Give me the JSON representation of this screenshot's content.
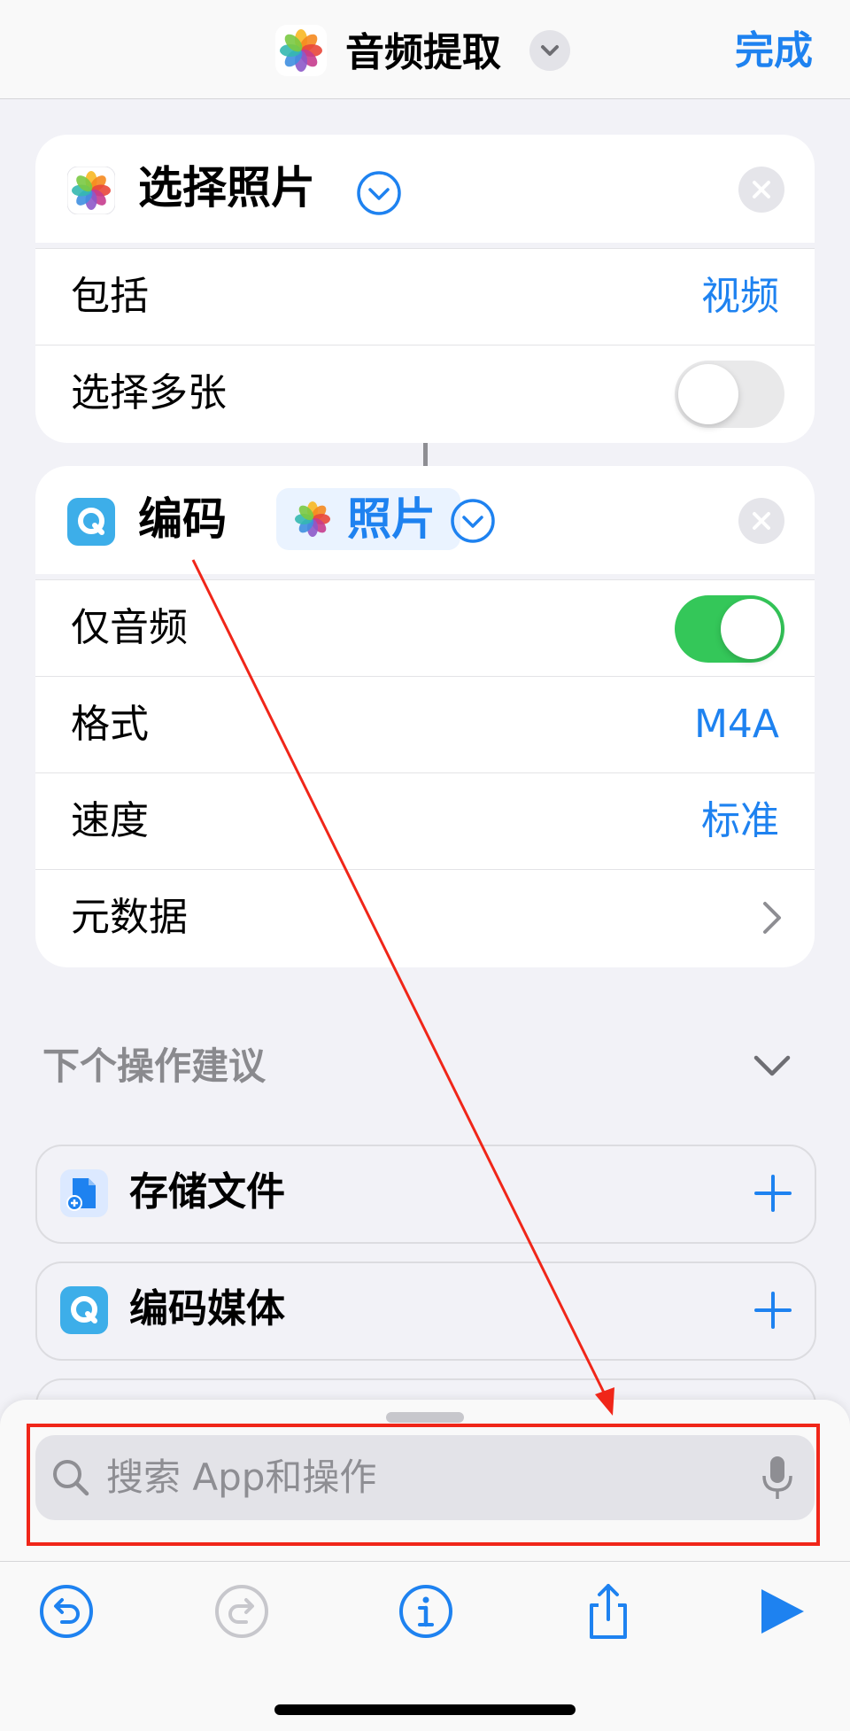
{
  "nav": {
    "title": "音频提取",
    "done_label": "完成"
  },
  "select_photos_action": {
    "title": "选择照片",
    "rows": [
      {
        "label": "包括",
        "value": "视频"
      },
      {
        "label": "选择多张",
        "toggle": "off"
      }
    ]
  },
  "encode_action": {
    "title": "编码",
    "input_chip": "照片",
    "rows": [
      {
        "label": "仅音频",
        "toggle": "on"
      },
      {
        "label": "格式",
        "value": "M4A"
      },
      {
        "label": "速度",
        "value": "标准"
      },
      {
        "label": "元数据"
      }
    ]
  },
  "suggestions": {
    "header": "下个操作建议",
    "items": [
      {
        "label": "存储文件"
      },
      {
        "label": "编码媒体"
      }
    ]
  },
  "search": {
    "placeholder": "搜索 App和操作"
  },
  "colors": {
    "accent": "#1e82f0",
    "toggle_on": "#34c759",
    "annotation_red": "#f02619",
    "background": "#f2f2f7"
  }
}
